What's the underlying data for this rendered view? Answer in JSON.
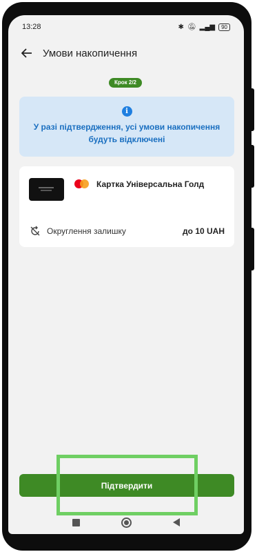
{
  "status_bar": {
    "time": "13:28",
    "battery": "90"
  },
  "header": {
    "title": "Умови накопичення"
  },
  "step": {
    "label": "Крок 2/2"
  },
  "info": {
    "text_line1": "У разі підтвердження, усі умови накопичення",
    "text_line2": "будуть відключені"
  },
  "card": {
    "name": "Картка Універсальна Голд",
    "rounding_label": "Округлення залишку",
    "rounding_value": "до 10 UAH"
  },
  "actions": {
    "confirm_label": "Підтвердити"
  },
  "colors": {
    "accent_green": "#3e8a25",
    "info_blue": "#1a6fc0",
    "info_bg": "#d6e7f7",
    "highlight": "#6fcf63"
  }
}
